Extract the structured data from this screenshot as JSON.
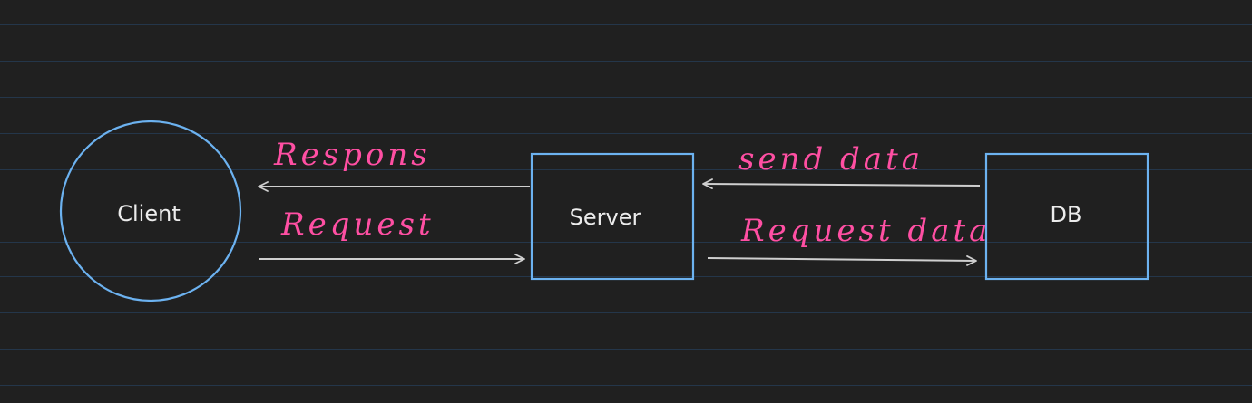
{
  "nodes": {
    "client": "Client",
    "server": "Server",
    "db": "DB"
  },
  "arrows": {
    "server_to_client": "Respons",
    "client_to_server": "Request",
    "db_to_server": "send data",
    "server_to_db": "Request data"
  },
  "colors": {
    "background": "#202020",
    "ruled_lines": "#24364a",
    "shape_stroke": "#6cb2f0",
    "arrow": "#cfcfcf",
    "annotation": "#ff4fa3"
  }
}
